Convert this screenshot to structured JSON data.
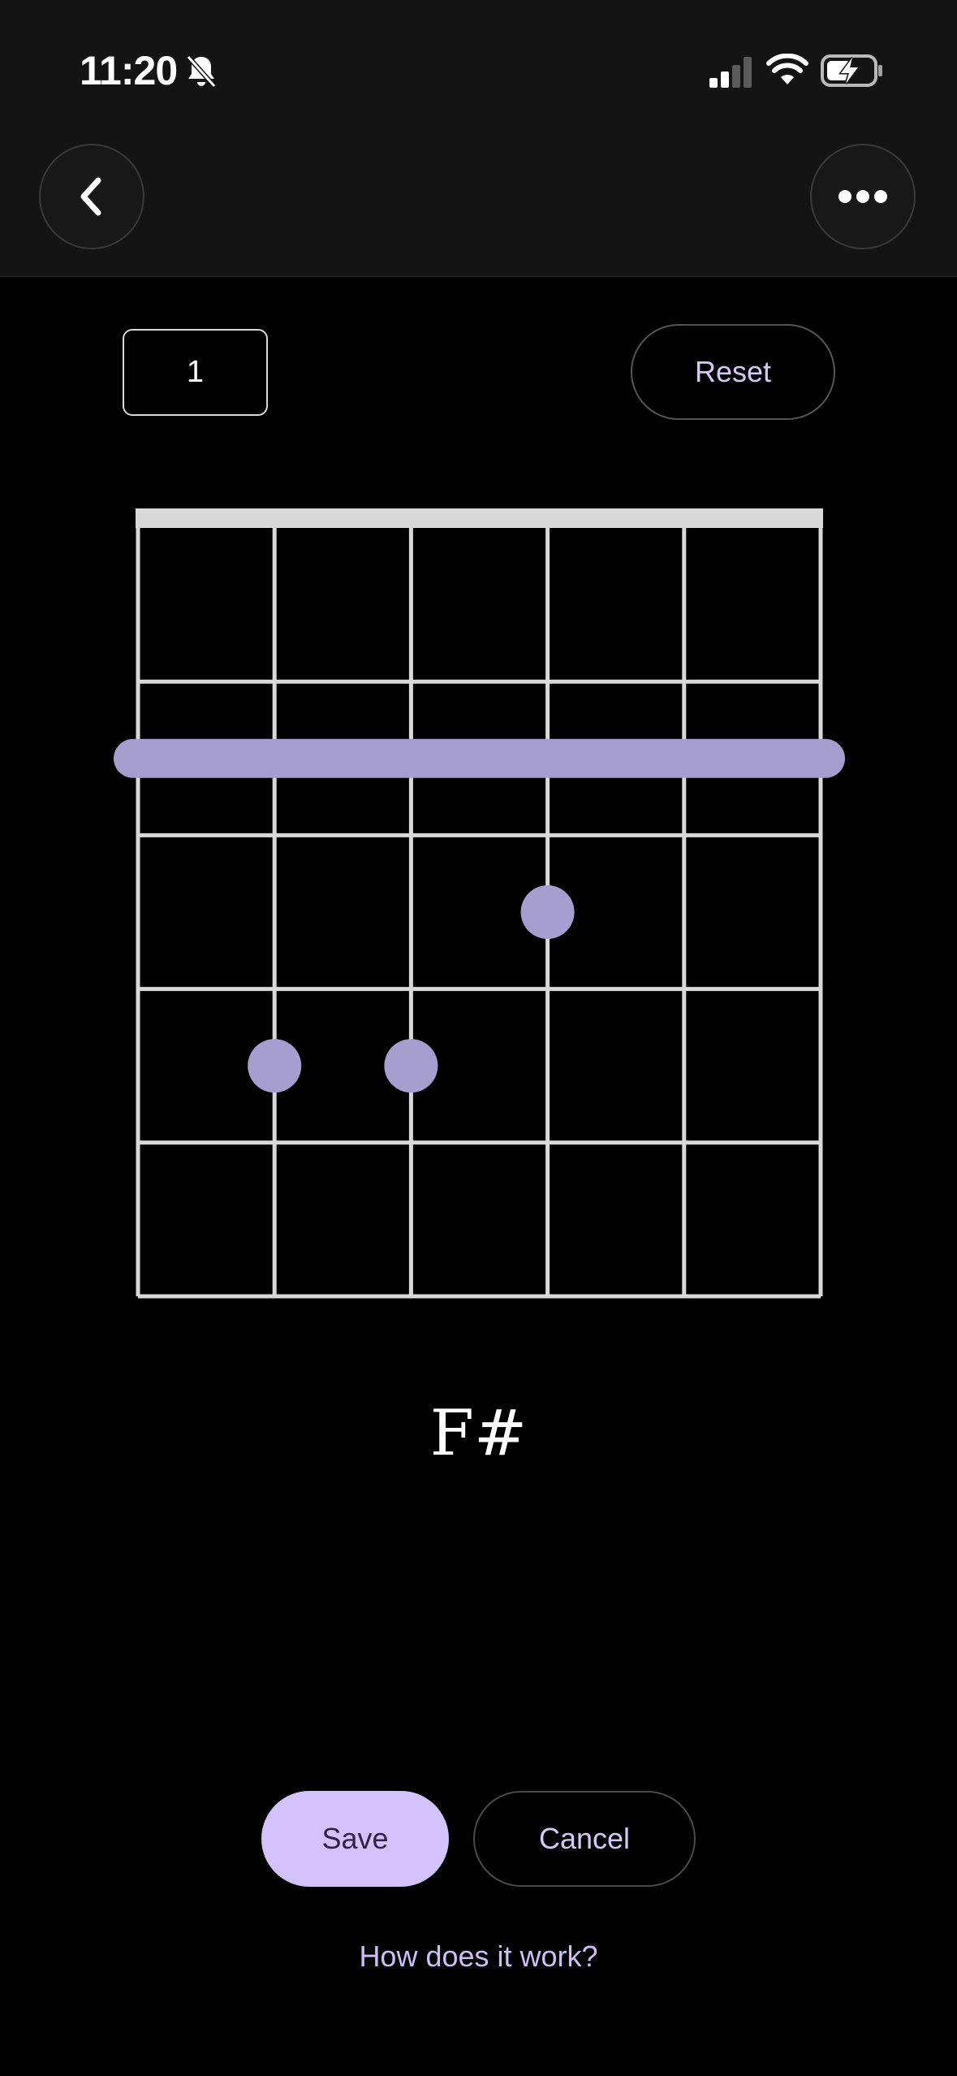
{
  "status_bar": {
    "time": "11:20",
    "icons": [
      "bell-slash-icon",
      "cellular-signal-icon",
      "wifi-icon",
      "battery-charging-icon"
    ]
  },
  "nav": {
    "back_icon": "chevron-left-icon",
    "more_icon": "ellipsis-icon"
  },
  "controls": {
    "fret_value": "1",
    "reset_label": "Reset"
  },
  "chord_diagram": {
    "strings": 6,
    "frets_shown": 5,
    "barre": {
      "fret": 2,
      "from_string": 1,
      "to_string": 6
    },
    "dots": [
      {
        "string": 4,
        "fret": 3
      },
      {
        "string": 2,
        "fret": 4
      },
      {
        "string": 3,
        "fret": 4
      }
    ],
    "accent": "#a59ecf",
    "line_color": "#d9d9d9"
  },
  "chord_name": "F#",
  "actions": {
    "save_label": "Save",
    "cancel_label": "Cancel",
    "help_label": "How does it work?"
  },
  "colors": {
    "background": "#000000",
    "accent_button": "#d3c2fb",
    "accent_text": "#d6c8f7"
  }
}
